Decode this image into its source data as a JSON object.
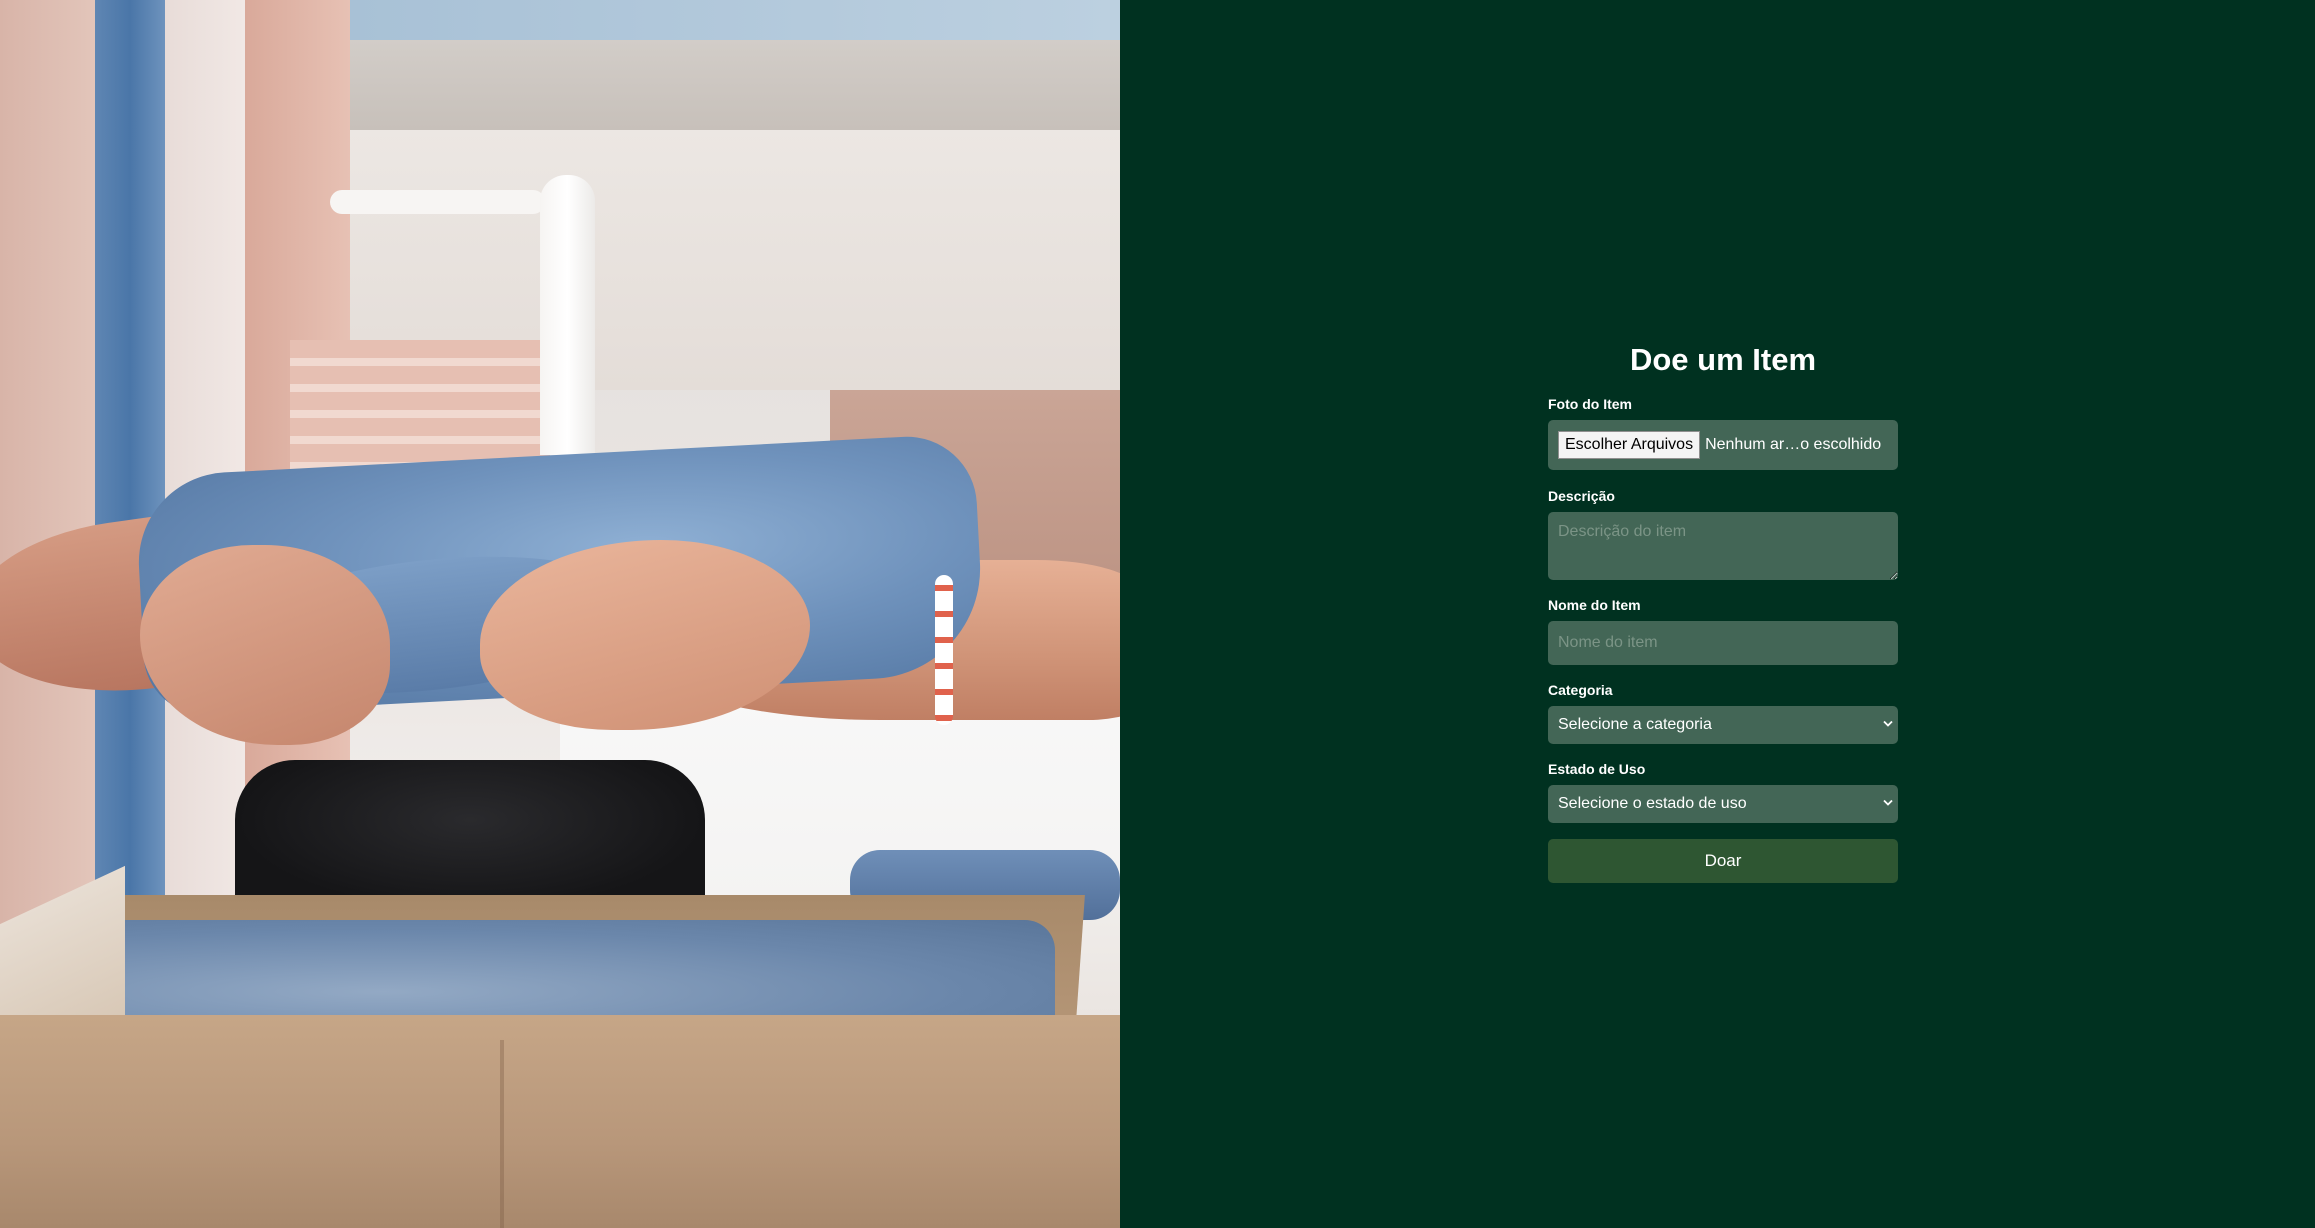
{
  "photo": {
    "description_icon": "donation-photo"
  },
  "form": {
    "title": "Doe um Item",
    "photo": {
      "label": "Foto do Item",
      "button_label": "Escolher Arquivos",
      "status_text": "Nenhum ar…o escolhido"
    },
    "description": {
      "label": "Descrição",
      "placeholder": "Descrição do item",
      "value": ""
    },
    "name": {
      "label": "Nome do Item",
      "placeholder": "Nome do item",
      "value": ""
    },
    "category": {
      "label": "Categoria",
      "selected": "Selecione a categoria"
    },
    "condition": {
      "label": "Estado de Uso",
      "selected": "Selecione o estado de uso"
    },
    "submit_label": "Doar"
  },
  "colors": {
    "panel_background": "#003120",
    "field_background": "#436656",
    "button_background": "#2e5632",
    "text": "#ffffff",
    "placeholder": "#7b9486"
  }
}
